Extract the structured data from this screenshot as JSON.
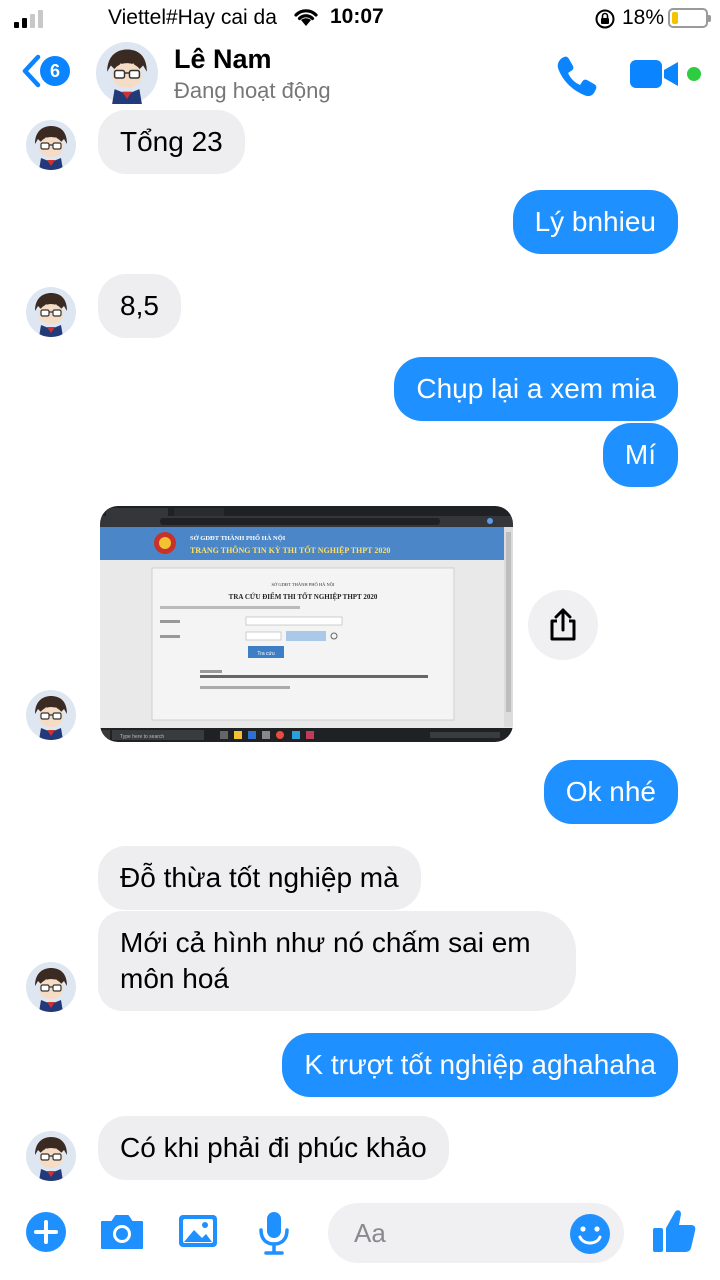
{
  "status_bar": {
    "carrier": "Viettel#Hay cai da",
    "time": "10:07",
    "battery_percent": "18%",
    "battery_level": 0.18
  },
  "header": {
    "back_badge": "6",
    "contact_name": "Lê Nam",
    "contact_status": "Đang hoạt động"
  },
  "messages": [
    {
      "sender": "them",
      "text": "Tổng 23"
    },
    {
      "sender": "me",
      "text": "Lý bnhieu"
    },
    {
      "sender": "them",
      "text": "8,5"
    },
    {
      "sender": "me",
      "text": "Chụp lại a xem mia"
    },
    {
      "sender": "me",
      "text": "Mí"
    },
    {
      "sender": "them",
      "type": "image"
    },
    {
      "sender": "me",
      "text": "Ok nhé"
    },
    {
      "sender": "them",
      "text": "Đỗ thừa tốt nghiệp mà"
    },
    {
      "sender": "them",
      "text": "Mới cả hình như nó chấm sai em"
    },
    {
      "sender": "them",
      "text": "môn hoá"
    },
    {
      "sender": "me",
      "text": "K trượt tốt nghiệp aghahaha"
    },
    {
      "sender": "them",
      "text": "Có khi phải đi phúc khảo"
    }
  ],
  "screenshot": {
    "dept": "SỞ GDĐT THÀNH PHỐ HÀ NỘI",
    "portal": "TRANG THÔNG TIN KỲ THI TỐT NGHIỆP THPT 2020",
    "form_dept": "SỞ GDĐT THÀNH PHỐ HÀ NỘI",
    "form_title": "TRA CỨU ĐIỂM THI TỐT NGHIỆP THPT 2020",
    "button": "Tra cứu",
    "taskbar_search": "Type here to search"
  },
  "composer": {
    "placeholder": "Aa"
  },
  "icons": {
    "add": "plus-circle-icon",
    "camera": "camera-icon",
    "gallery": "gallery-icon",
    "mic": "microphone-icon",
    "emoji": "emoji-icon",
    "like": "thumbs-up-icon",
    "share": "share-icon",
    "call": "phone-icon",
    "video": "video-camera-icon"
  },
  "colors": {
    "accent": "#1e90ff",
    "incoming_bubble": "#eeeef0",
    "active_dot": "#2ecc40"
  }
}
